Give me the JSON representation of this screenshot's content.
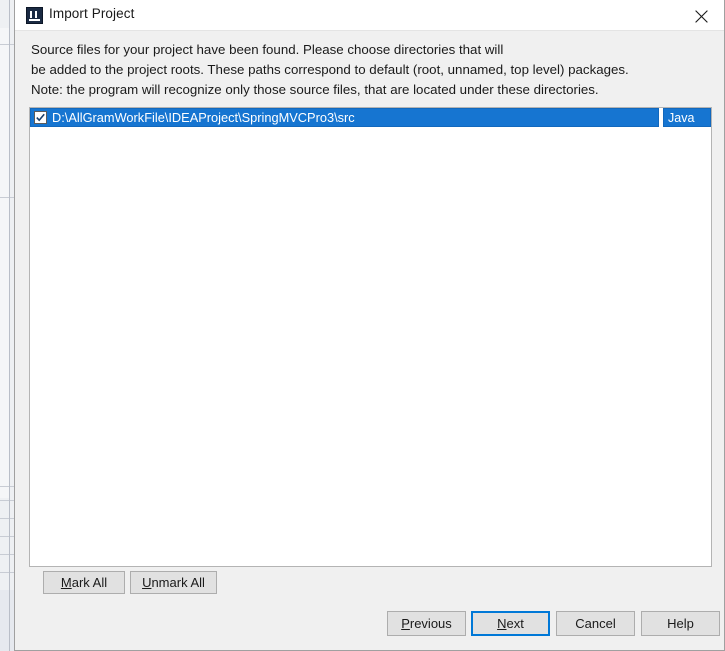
{
  "window": {
    "title": "Import Project",
    "icon": "intellij-idea-icon",
    "close_label": "✕"
  },
  "description": {
    "lines": [
      "Source files for your project have been found. Please choose directories that will",
      "be added to the project roots. These paths correspond to default (root, unnamed, top level) packages.",
      "Note: the program will recognize only those source files, that are located under these directories."
    ]
  },
  "source_list": {
    "rows": [
      {
        "checked": true,
        "path": "D:\\AllGramWorkFile\\IDEAProject\\SpringMVCPro3\\src",
        "type": "Java",
        "selected": true
      }
    ]
  },
  "mark_buttons": {
    "mark_all": {
      "pre": "",
      "accel": "M",
      "post": "ark All"
    },
    "unmark_all": {
      "pre": "",
      "accel": "U",
      "post": "nmark All"
    }
  },
  "action_buttons": {
    "previous": {
      "pre": "",
      "accel": "P",
      "post": "revious"
    },
    "next": {
      "pre": "",
      "accel": "N",
      "post": "ext"
    },
    "cancel": {
      "pre": "Cancel",
      "accel": "",
      "post": ""
    },
    "help": {
      "pre": "Help",
      "accel": "",
      "post": ""
    }
  },
  "colors": {
    "selection_blue": "#1675d1",
    "focus_blue": "#0078d7",
    "dialog_background": "#f0f0f0",
    "titlebar_background": "#ffffff",
    "list_background": "#ffffff"
  }
}
